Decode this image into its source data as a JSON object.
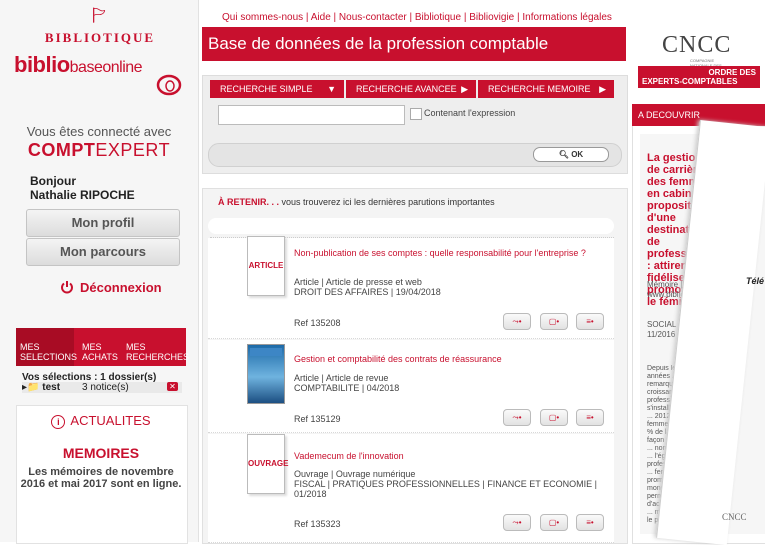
{
  "sidebar": {
    "logo_top": "BIBLIOTIQUE",
    "logo_main_bold": "biblio",
    "logo_main_thin": "baseonline",
    "connected_text": "Vous êtes connecté avec",
    "brand_bold": "COMPT",
    "brand_light": "EXPERT",
    "greeting": "Bonjour",
    "user_name": "Nathalie RIPOCHE",
    "profile_button": "Mon profil",
    "journey_button": "Mon parcours",
    "logout": "Déconnexion",
    "tabs": [
      {
        "line1": "MES",
        "line2": "SELECTIONS"
      },
      {
        "line1": "MES",
        "line2": "ACHATS"
      },
      {
        "line1": "MES",
        "line2": "RECHERCHES"
      }
    ],
    "selections_summary": "Vos sélections : 1 dossier(s)",
    "folder_name": "test",
    "folder_count": "3 notice(s)",
    "actualites_title": "ACTUALITES",
    "memoires_title": "MEMOIRES",
    "memoires_text": "Les mémoires de novembre 2016 et mai 2017 sont en ligne."
  },
  "top_links": [
    "Qui sommes-nous",
    "Aide",
    "Nous-contacter",
    "Bibliotique",
    "Bibliovigie",
    "Informations légales"
  ],
  "banner_title": "Base de données de la profession comptable",
  "search": {
    "tabs": [
      "RECHERCHE SIMPLE",
      "RECHERCHE AVANCEE",
      "RECHERCHE MEMOIRE"
    ],
    "input_value": "",
    "checkbox_label": "Contenant l'expression",
    "ok_label": "OK"
  },
  "retenir": {
    "title": "À RETENIR. . .",
    "subtitle": "vous trouverez ici les dernières parutions importantes",
    "items": [
      {
        "thumb": "ARTICLE",
        "title": "Non-publication de ses comptes : quelle responsabilité pour l'entreprise ?",
        "type": "Article | Article de presse et web",
        "meta": "DROIT DES AFFAIRES | 19/04/2018",
        "ref": "Ref 135208"
      },
      {
        "thumb": "",
        "title": "Gestion et comptabilité des contrats de réassurance",
        "type": "Article | Article de revue",
        "meta": "COMPTABILITE | 04/2018",
        "ref": "Ref 135129"
      },
      {
        "thumb": "OUVRAGE",
        "title": "Vademecum de l'innovation",
        "type": "Ouvrage | Ouvrage numérique",
        "meta": "FISCAL | PRATIQUES PROFESSIONNELLES | FINANCE ET ECONOMIE | 01/2018",
        "ref": "Ref 135323"
      }
    ]
  },
  "right": {
    "cncc_logo": "CNCC",
    "cncc_sub": "COMPAGNIE NATIONALE DES COMMISSAIRES AUX COMPTES",
    "oec_line1": "ORDRE DES",
    "oec_line2": "EXPERTS-COMPTABLES",
    "section_title": "A DECOUVRIR",
    "feature_title": "La gestion de carrière des femmes en cabinet : proposition d'une destination de professionnelles : attirer, fidéliser, promouvoir le féminin",
    "feature_meta1": "Mémoire | Mémoire",
    "feature_meta2": "www.bibliobaseonline",
    "feature_meta3": "SOCIAL | MANAGEMENT",
    "feature_meta4": "11/2016",
    "feature_body": "Depuis les années ... peut remarquer une croissante des professionnelles s'installer dans ... 2012, les femmes ... 48 % de la ... façon concrète ... nombreuses ... l'égalité professionnelle ... femme ont ... promouvoir ... monde du ... permettre ... d'accéder aux ... métiers et ... le poids ... encore l...",
    "paper_text": "Télé",
    "paper_logo": "CNCC"
  }
}
